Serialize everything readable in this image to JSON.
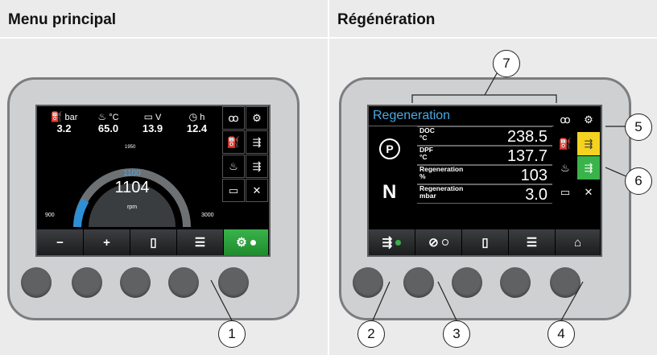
{
  "panels": [
    {
      "title": "Menu principal"
    },
    {
      "title": "Régénération"
    }
  ],
  "main_menu": {
    "gauges": [
      {
        "icon": "oil-can-icon",
        "unit": "bar",
        "value": "3.2"
      },
      {
        "icon": "coolant-temp-icon",
        "unit": "°C",
        "value": "65.0"
      },
      {
        "icon": "battery-icon",
        "unit": "V",
        "value": "13.9"
      },
      {
        "icon": "clock-icon",
        "unit": "h",
        "value": "12.4"
      }
    ],
    "rpm": {
      "target": "1100",
      "value": "1104",
      "unit": "rpm",
      "scale_top": "1950",
      "scale_min": "900",
      "scale_max": "3000"
    },
    "softkeys": [
      "−",
      "+",
      "",
      "",
      ""
    ]
  },
  "regeneration_screen": {
    "title": "Regeneration",
    "gear_p": "P",
    "gear_n": "N",
    "rows": [
      {
        "label": "DOC\n°C",
        "value": "238.5"
      },
      {
        "label": "DPF\n°C",
        "value": "137.7"
      },
      {
        "label": "Regeneration\n%",
        "value": "103"
      },
      {
        "label": "Regeneration\nmbar",
        "value": "3.0"
      }
    ]
  },
  "callouts": [
    "1",
    "2",
    "3",
    "4",
    "5",
    "6",
    "7"
  ],
  "colors": {
    "bg_panel": "#ebebeb",
    "accent_blue": "#4aa9e0",
    "status_green": "#39b34a",
    "warning_yellow": "#f4d21f"
  }
}
